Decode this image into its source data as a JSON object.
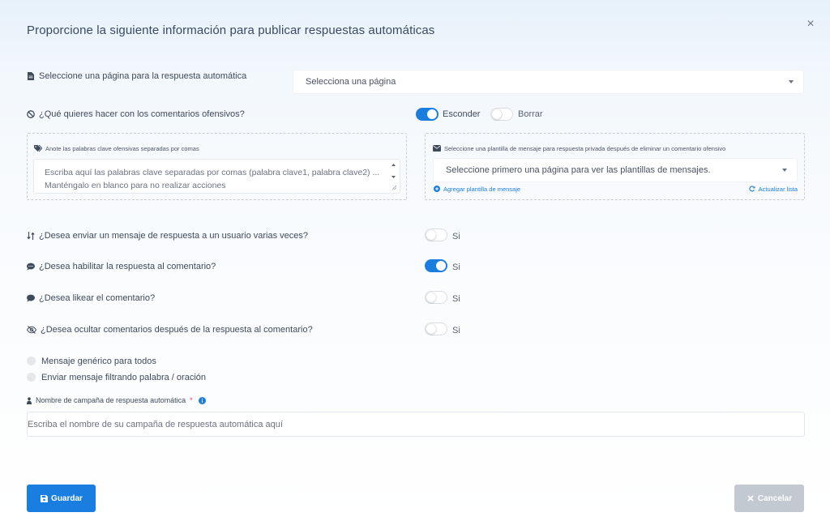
{
  "dialog": {
    "title": "Proporcione la siguiente información para publicar respuestas automáticas",
    "close_label": "×"
  },
  "page_select": {
    "label": "Seleccione una página para la respuesta automática",
    "value": "Selecciona una página"
  },
  "offensive": {
    "question": "¿Qué quieres hacer con los comentarios ofensivos?",
    "option_hide": "Esconder",
    "option_hide_on": true,
    "option_delete": "Borrar",
    "option_delete_on": false,
    "keywords_label": "Anote las palabras clave ofensivas separadas por comas",
    "keywords_placeholder": "Escriba aquí las palabras clave separadas por comas (palabra clave1, palabra clave2) ... Manténgalo en blanco para no realizar acciones",
    "template_label": "Seleccione una plantilla de mensaje para respuesta privada después de eliminar un comentario ofensivo",
    "template_value": "Seleccione primero una página para ver las plantillas de mensajes.",
    "add_template_link": "Agregar plantilla de mensaje",
    "refresh_link": "Actualizar lista"
  },
  "settings": [
    {
      "icon": "sort-icon",
      "question": "¿Desea enviar un mensaje de respuesta a un usuario varias veces?",
      "toggle_label": "Si",
      "on": false
    },
    {
      "icon": "comment-dots-icon",
      "question": "¿Desea habilitar la respuesta al comentario?",
      "toggle_label": "Si",
      "on": true
    },
    {
      "icon": "comment-icon",
      "question": "¿Desea likear el comentario?",
      "toggle_label": "Si",
      "on": false
    },
    {
      "icon": "eye-slash-icon",
      "question": "¿Desea ocultar comentarios después de la respuesta al comentario?",
      "toggle_label": "Si",
      "on": false
    }
  ],
  "reply_mode": {
    "options": [
      "Mensaje genérico para todos",
      "Enviar mensaje filtrando palabra / oración"
    ]
  },
  "campaign": {
    "label": "Nombre de campaña de respuesta automática",
    "required_mark": "*",
    "placeholder": "Escriba el nombre de su campaña de respuesta automática aquí"
  },
  "actions": {
    "save_label": "Guardar",
    "cancel_label": "Cancelar"
  },
  "colors": {
    "accent": "#1a7ee0",
    "disabled": "#c3c9d1"
  }
}
